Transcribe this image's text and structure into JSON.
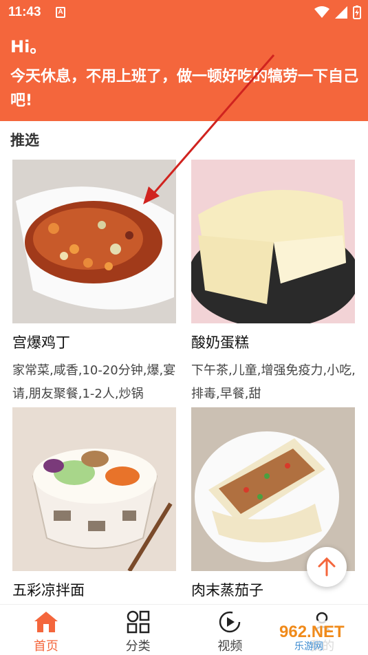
{
  "status_bar": {
    "time": "11:43",
    "notification_letter": "A"
  },
  "header": {
    "greeting": "Hi。",
    "message": "今天休息，不用上班了，做一顿好吃的犒劳一下自己吧!"
  },
  "section": {
    "title": "推选"
  },
  "recipes": [
    {
      "name": "宫爆鸡丁",
      "tags": "家常菜,咸香,10-20分钟,爆,宴请,朋友聚餐,1-2人,炒锅"
    },
    {
      "name": "酸奶蛋糕",
      "tags": "下午茶,儿童,增强免疫力,小吃,排毒,早餐,甜"
    },
    {
      "name": "五彩凉拌面",
      "tags": ""
    },
    {
      "name": "肉末蒸茄子",
      "tags": ""
    }
  ],
  "tabs": [
    {
      "label": "首页",
      "icon": "home-icon",
      "active": true
    },
    {
      "label": "分类",
      "icon": "category-icon",
      "active": false
    },
    {
      "label": "视频",
      "icon": "video-icon",
      "active": false
    },
    {
      "label": "我的",
      "icon": "profile-icon",
      "active": false
    }
  ],
  "watermark": {
    "text": "962.NET",
    "sub": "乐游网"
  },
  "colors": {
    "accent": "#f4663c",
    "text": "#222222"
  }
}
